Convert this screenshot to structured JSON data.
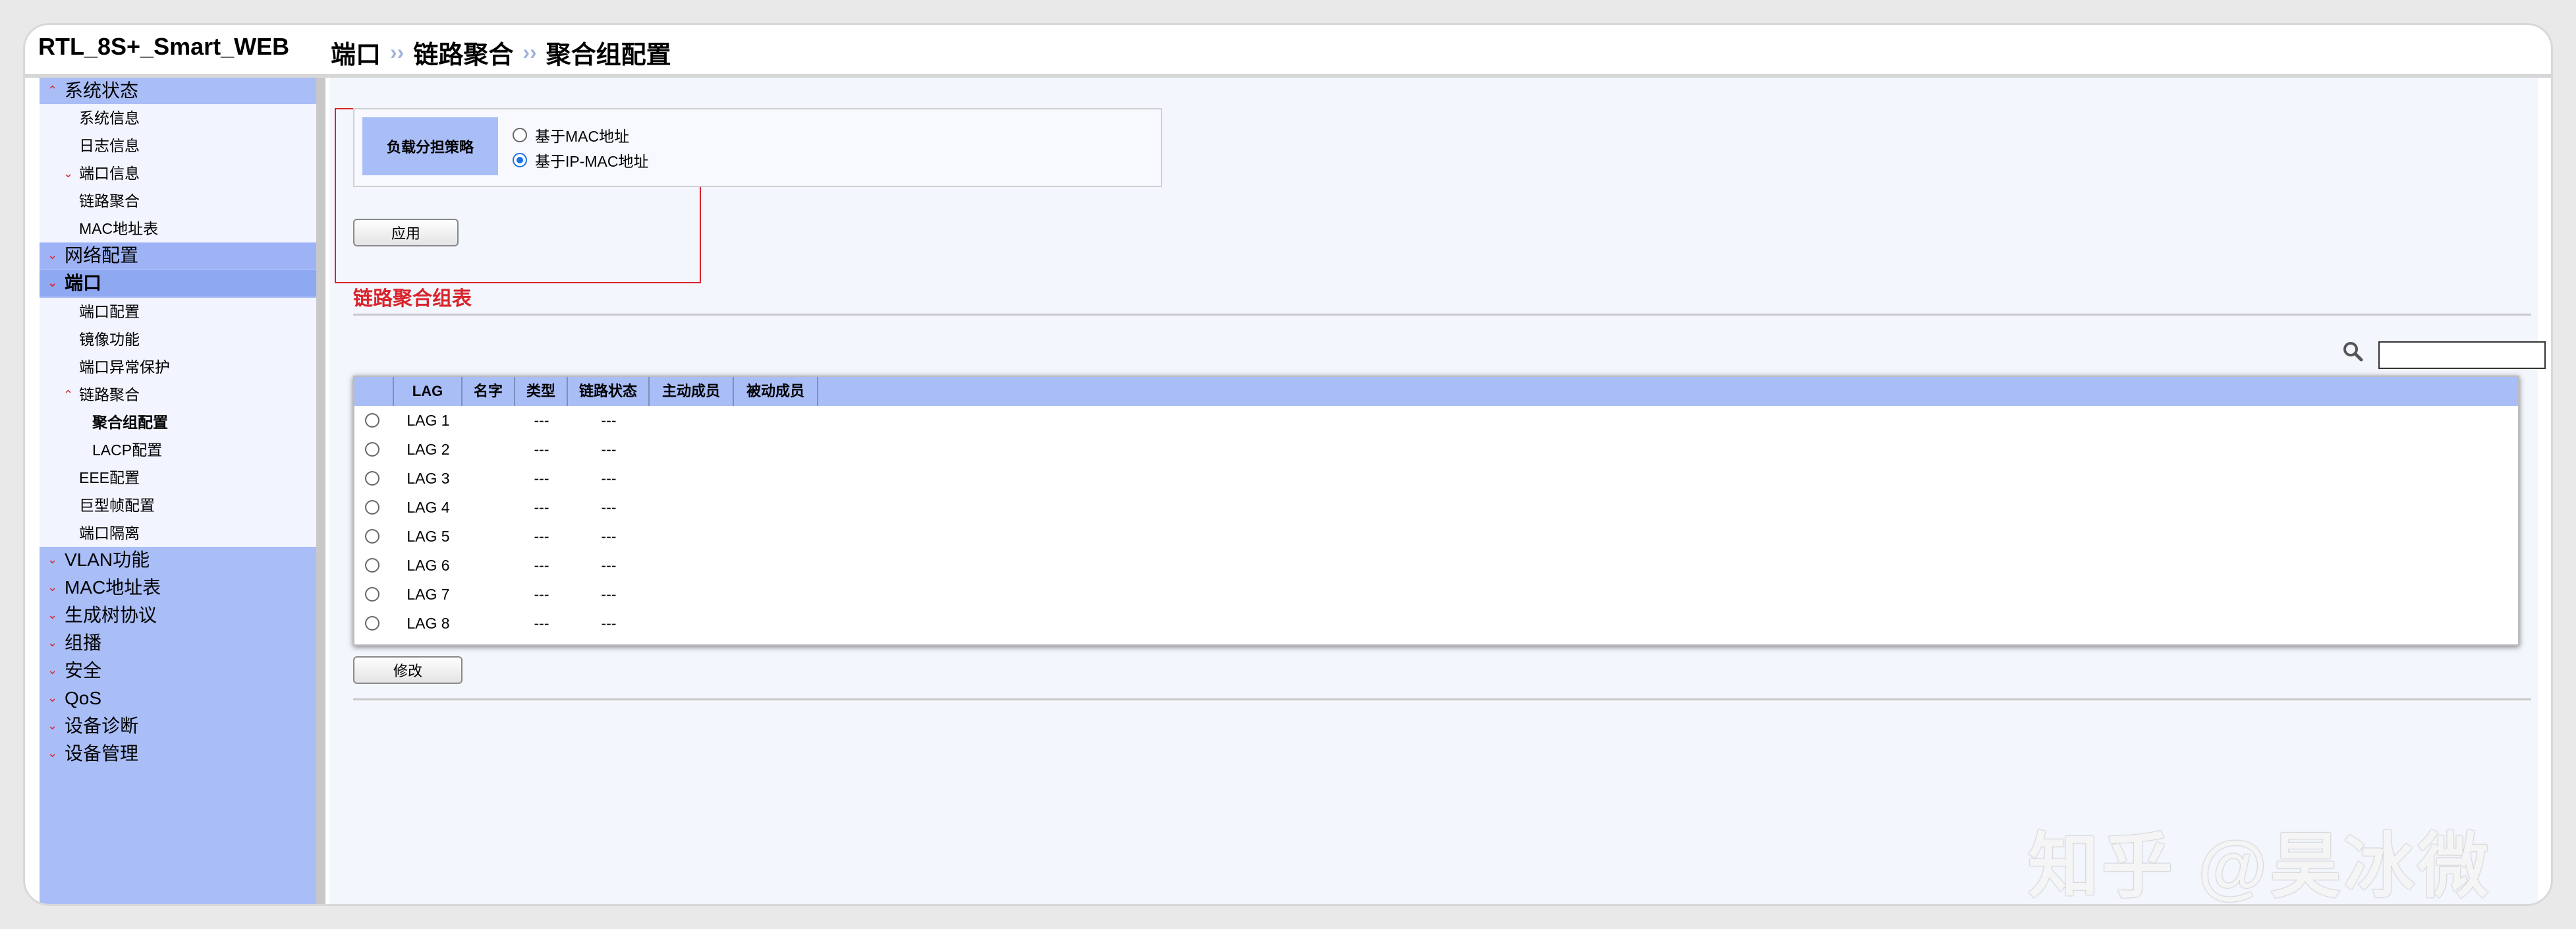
{
  "app": {
    "title": "RTL_8S+_Smart_WEB"
  },
  "breadcrumb": {
    "items": [
      "端口",
      "链路聚合",
      "聚合组配置"
    ],
    "separator": "››"
  },
  "sidebar": {
    "groups": [
      {
        "label": "系统状态",
        "expanded": true,
        "children": [
          {
            "label": "系统信息"
          },
          {
            "label": "日志信息"
          },
          {
            "label": "端口信息",
            "collapsible": true
          },
          {
            "label": "链路聚合"
          },
          {
            "label": "MAC地址表"
          }
        ]
      },
      {
        "label": "网络配置",
        "expanded": false,
        "children": []
      },
      {
        "label": "端口",
        "expanded": true,
        "children": [
          {
            "label": "端口配置"
          },
          {
            "label": "镜像功能"
          },
          {
            "label": "端口异常保护"
          },
          {
            "label": "链路聚合",
            "collapsible": true
          },
          {
            "label": "聚合组配置",
            "level": 2,
            "active": true
          },
          {
            "label": "LACP配置",
            "level": 2
          },
          {
            "label": "EEE配置"
          },
          {
            "label": "巨型帧配置"
          },
          {
            "label": "端口隔离"
          }
        ]
      },
      {
        "label": "VLAN功能"
      },
      {
        "label": "MAC地址表"
      },
      {
        "label": "生成树协议"
      },
      {
        "label": "组播"
      },
      {
        "label": "安全"
      },
      {
        "label": "QoS"
      },
      {
        "label": "设备诊断"
      },
      {
        "label": "设备管理"
      }
    ]
  },
  "policy": {
    "label": "负载分担策略",
    "options": [
      "基于MAC地址",
      "基于IP-MAC地址"
    ],
    "selected_index": 1,
    "apply_button": "应用"
  },
  "lag_section": {
    "title": "链路聚合组表",
    "columns": [
      "",
      "LAG",
      "名字",
      "类型",
      "链路状态",
      "主动成员",
      "被动成员"
    ],
    "rows": [
      {
        "lag": "LAG 1",
        "name": "",
        "type": "---",
        "status": "---",
        "active": "",
        "passive": ""
      },
      {
        "lag": "LAG 2",
        "name": "",
        "type": "---",
        "status": "---",
        "active": "",
        "passive": ""
      },
      {
        "lag": "LAG 3",
        "name": "",
        "type": "---",
        "status": "---",
        "active": "",
        "passive": ""
      },
      {
        "lag": "LAG 4",
        "name": "",
        "type": "---",
        "status": "---",
        "active": "",
        "passive": ""
      },
      {
        "lag": "LAG 5",
        "name": "",
        "type": "---",
        "status": "---",
        "active": "",
        "passive": ""
      },
      {
        "lag": "LAG 6",
        "name": "",
        "type": "---",
        "status": "---",
        "active": "",
        "passive": ""
      },
      {
        "lag": "LAG 7",
        "name": "",
        "type": "---",
        "status": "---",
        "active": "",
        "passive": ""
      },
      {
        "lag": "LAG 8",
        "name": "",
        "type": "---",
        "status": "---",
        "active": "",
        "passive": ""
      }
    ],
    "search_value": "",
    "modify_button": "修改"
  },
  "watermark": {
    "text": "知乎 @昊冰微"
  },
  "colors": {
    "accent": "#a9bdf7",
    "highlight_red": "#d8242c",
    "chevron": "#e0202c"
  }
}
